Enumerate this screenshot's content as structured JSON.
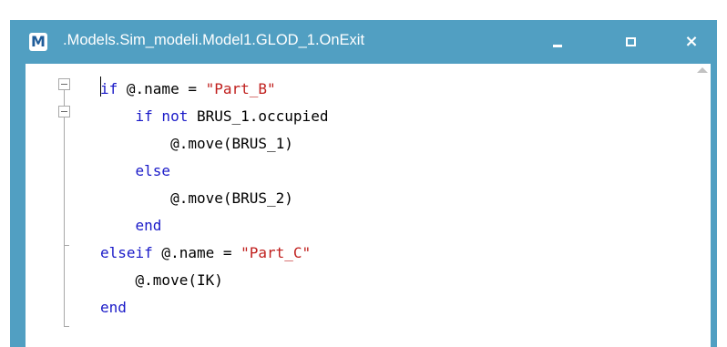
{
  "window": {
    "title": ".Models.Sim_modeli.Model1.GLOD_1.OnExit",
    "app_icon_letter": "M",
    "titlebar_color": "#519fc2",
    "controls": {
      "minimize_icon": "minimize-icon",
      "maximize_icon": "maximize-icon",
      "close_icon": "close-icon",
      "close_glyph": "×"
    }
  },
  "editor": {
    "colors": {
      "keyword": "#1a1ac8",
      "string": "#c0201e",
      "text": "#000000"
    },
    "lines": [
      {
        "indent": "",
        "parts": [
          {
            "t": "if",
            "k": "kw"
          },
          {
            "t": " @.name = ",
            "k": "plain"
          },
          {
            "t": "\"Part_B\"",
            "k": "str"
          }
        ]
      },
      {
        "indent": "    ",
        "parts": [
          {
            "t": "if not",
            "k": "kw"
          },
          {
            "t": " BRUS_1.occupied",
            "k": "plain"
          }
        ]
      },
      {
        "indent": "        ",
        "parts": [
          {
            "t": "@.move(BRUS_1)",
            "k": "plain"
          }
        ]
      },
      {
        "indent": "    ",
        "parts": [
          {
            "t": "else",
            "k": "kw"
          }
        ]
      },
      {
        "indent": "        ",
        "parts": [
          {
            "t": "@.move(BRUS_2)",
            "k": "plain"
          }
        ]
      },
      {
        "indent": "    ",
        "parts": [
          {
            "t": "end",
            "k": "kw"
          }
        ]
      },
      {
        "indent": "",
        "parts": [
          {
            "t": "elseif",
            "k": "kw"
          },
          {
            "t": " @.name = ",
            "k": "plain"
          },
          {
            "t": "\"Part_C\"",
            "k": "str"
          }
        ]
      },
      {
        "indent": "    ",
        "parts": [
          {
            "t": "@.move(IK)",
            "k": "plain"
          }
        ]
      },
      {
        "indent": "",
        "parts": [
          {
            "t": "end",
            "k": "kw"
          }
        ]
      }
    ]
  }
}
